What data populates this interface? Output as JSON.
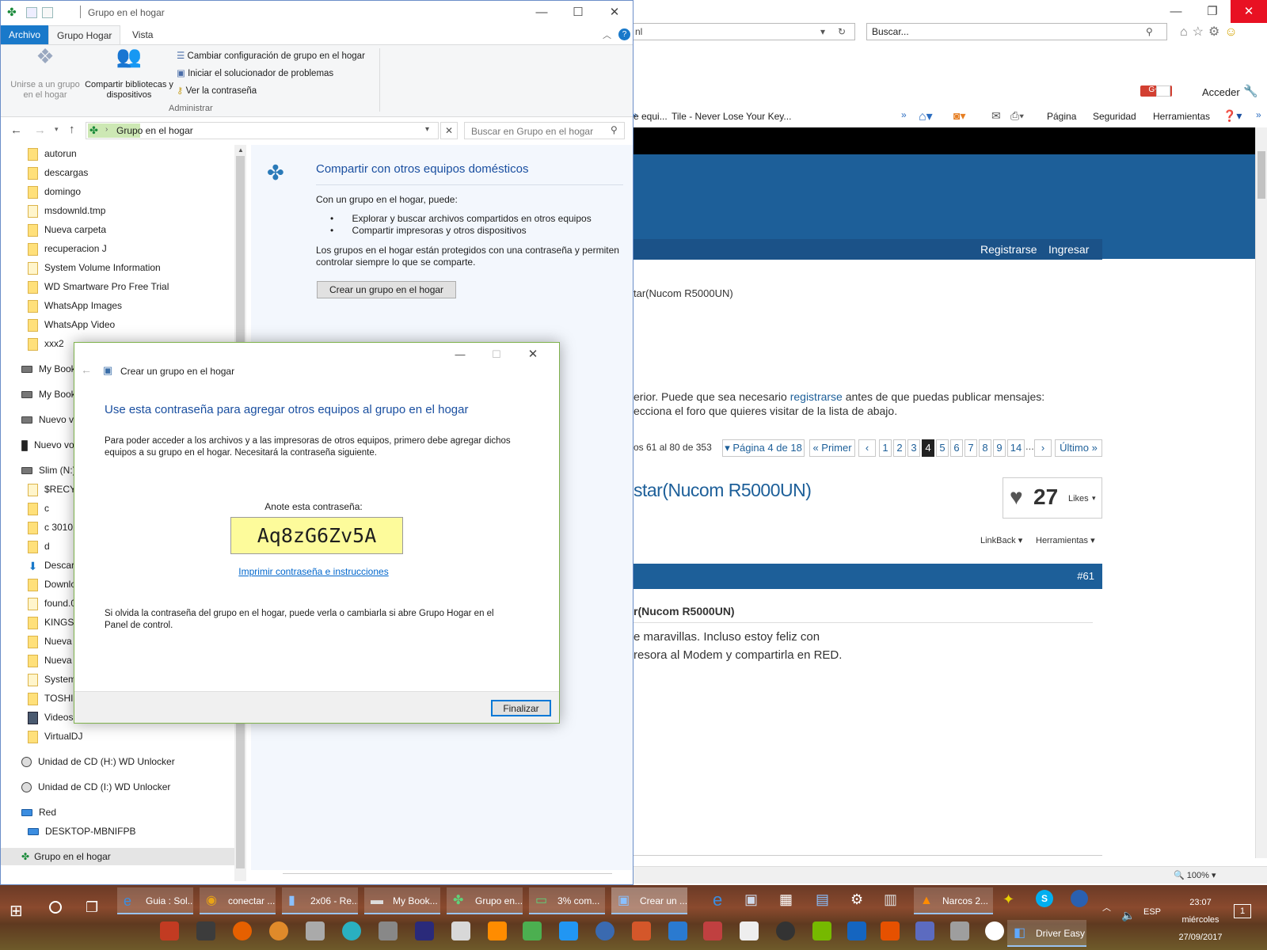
{
  "browser": {
    "address_fragment": "nl",
    "search_placeholder": "Buscar...",
    "acceder_label": "Acceder",
    "fav_items": [
      "e equi...",
      "Tile - Never Lose Your Key..."
    ],
    "toolbar": {
      "pagina": "Página",
      "seguridad": "Seguridad",
      "herramientas": "Herramientas"
    },
    "nav_links": {
      "register": "Registrarse",
      "login": "Ingresar"
    },
    "breadcrumb_fragment": "tar(Nucom R5000UN)",
    "notice_line1_pre": "erior. Puede que sea necesario ",
    "notice_link": "registrarse",
    "notice_line1_post": " antes de que puedas publicar mensajes:",
    "notice_line2": "ecciona el foro que quieres visitar de la lista de abajo.",
    "results_text": "os 61 al 80 de 353",
    "pager": {
      "page_of": "Página 4 de 18",
      "first": "Primer",
      "pages": [
        "1",
        "2",
        "3",
        "4",
        "5",
        "6",
        "7",
        "8",
        "9",
        "14"
      ],
      "current": "4",
      "ellipsis": "...",
      "last": "Último"
    },
    "thread_title": "star(Nucom R5000UN)",
    "likes_count": "27",
    "likes_label": "Likes",
    "linkback_label": "LinkBack",
    "tools_label": "Herramientas",
    "post_number": "#61",
    "post_title": "r(Nucom R5000UN)",
    "post_line1": "e maravillas. Incluso estoy feliz con",
    "post_line2": "resora al Modem y compartirla en RED.",
    "zoom": "100%"
  },
  "explorer": {
    "title": "Grupo en el hogar",
    "tabs": {
      "file": "Archivo",
      "home": "Grupo Hogar",
      "view": "Vista"
    },
    "ribbon": {
      "join": "Unirse a un grupo en el hogar",
      "share": "Compartir bibliotecas y dispositivos",
      "change_settings": "Cambiar configuración de grupo en el hogar",
      "troubleshoot": "Iniciar el solucionador de problemas",
      "view_password": "Ver la contraseña",
      "group_label": "Administrar"
    },
    "address": "Grupo en el hogar",
    "search_placeholder": "Buscar en Grupo en el hogar",
    "tree": [
      "autorun",
      "descargas",
      "domingo",
      "msdownld.tmp",
      "Nueva carpeta",
      "recuperacion J",
      "System Volume Information",
      "WD Smartware Pro Free Trial",
      "WhatsApp Images",
      "WhatsApp Video",
      "xxx2",
      "My Book",
      "My Book",
      "Nuevo vo",
      "Nuevo vo",
      "Slim (N:)",
      "$RECYC",
      "c",
      "c 30101",
      "d",
      "Descarg",
      "Downlo",
      "found.0",
      "KINGST",
      "Nueva c",
      "Nueva c",
      "System",
      "TOSHIB",
      "Videos",
      "VirtualDJ",
      "Unidad de CD (H:) WD Unlocker",
      "Unidad de CD (I:) WD Unlocker",
      "Red",
      "DESKTOP-MBNIFPB",
      "Grupo en el hogar"
    ],
    "content": {
      "heading": "Compartir con otros equipos domésticos",
      "intro": "Con un grupo en el hogar, puede:",
      "bullet1": "Explorar y buscar archivos compartidos en otros equipos",
      "bullet2": "Compartir impresoras y otros dispositivos",
      "para1": "Los grupos en el hogar están protegidos con una contraseña y permiten",
      "para2": "controlar siempre lo que se comparte.",
      "create_button": "Crear un grupo en el hogar"
    }
  },
  "dialog": {
    "title": "Crear un grupo en el hogar",
    "heading": "Use esta contraseña para agregar otros equipos al grupo en el hogar",
    "body1": "Para poder acceder a los archivos y a las impresoras de otros equipos, primero debe agregar dichos",
    "body2": "equipos a su grupo en el hogar. Necesitará la contraseña siguiente.",
    "note_label": "Anote esta contraseña:",
    "password": "Aq8zG6Zv5A",
    "print_link": "Imprimir contraseña e instrucciones",
    "forgot1": "Si olvida la contraseña del grupo en el hogar, puede verla o cambiarla si abre Grupo Hogar en el",
    "forgot2": "Panel de control.",
    "finish": "Finalizar"
  },
  "taskbar": {
    "tasks": [
      "Guia : Sol...",
      "conectar ...",
      "2x06 - Re...",
      "My Book...",
      "Grupo en...",
      "3% com...",
      "Crear un ..."
    ],
    "task2": "Narcos 2...",
    "driver_easy": "Driver Easy",
    "lang": "ESP",
    "time": "23:07",
    "day": "miércoles",
    "date": "27/09/2017",
    "notifications": "1"
  },
  "colors": {
    "accent": "#1979ca",
    "forum_blue": "#1d5f99",
    "password_bg": "#fdfb9b",
    "dialog_border": "#7fb24c"
  }
}
